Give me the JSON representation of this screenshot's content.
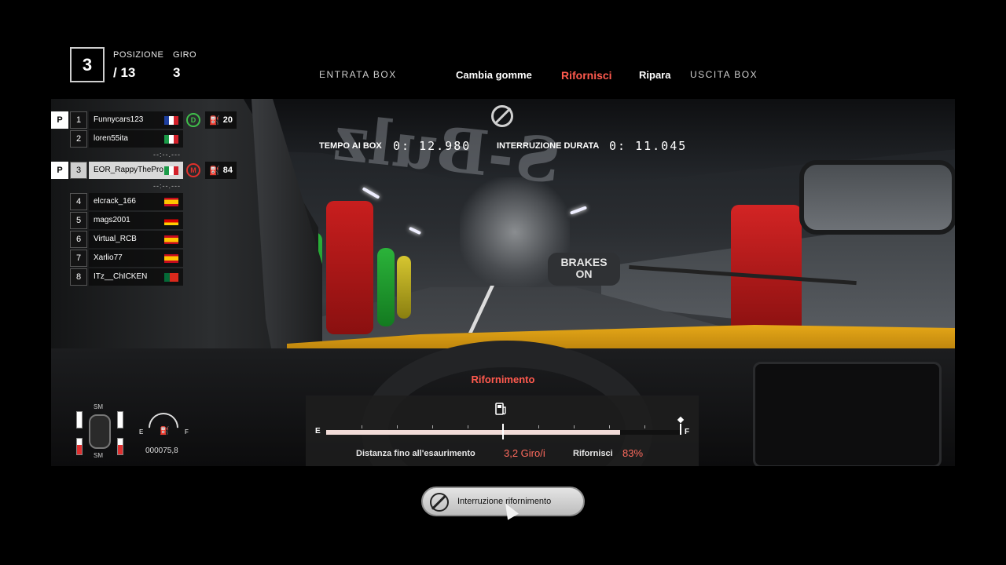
{
  "hud": {
    "position": "3",
    "position_label": "POSIZIONE",
    "position_total": "/ 13",
    "lap_label": "GIRO",
    "lap_value": "3"
  },
  "pit_menu": {
    "entry": "ENTRATA BOX",
    "tyres": "Cambia gomme",
    "refuel": "Rifornisci",
    "repair": "Ripara",
    "exit": "USCITA BOX"
  },
  "timers": {
    "pit_time_label": "TEMPO AI BOX",
    "pit_time_value": "0: 12.980",
    "stop_duration_label": "INTERRUZIONE DURATA",
    "stop_duration_value": "0: 11.045"
  },
  "leaderboard": {
    "rows": [
      {
        "pos": "1",
        "name": "Funnycars123",
        "flag": "fr",
        "p_badge": "P",
        "tyre": "D",
        "fuel": "20"
      },
      {
        "pos": "2",
        "name": "loren55ita",
        "flag": "it"
      },
      {
        "pos": "3",
        "name": "EOR_RappyThePro",
        "flag": "it",
        "p_badge": "P",
        "tyre": "M",
        "fuel": "84"
      },
      {
        "pos": "4",
        "name": "elcrack_166",
        "flag": "es"
      },
      {
        "pos": "5",
        "name": "mags2001",
        "flag": "de"
      },
      {
        "pos": "6",
        "name": "Virtual_RCB",
        "flag": "es"
      },
      {
        "pos": "7",
        "name": "Xarlio77",
        "flag": "es"
      },
      {
        "pos": "8",
        "name": "ITz__ChICKEN",
        "flag": "pt"
      }
    ],
    "gap_placeholder": "--:--.---"
  },
  "car_status": {
    "tyre_label_front": "SM",
    "tyre_label_rear": "SM",
    "gauge_e": "E",
    "gauge_f": "F",
    "odometer": "000075,8"
  },
  "scene": {
    "sign_text_1": "BRAKES",
    "sign_text_2": "ON"
  },
  "refuel": {
    "title": "Rifornimento",
    "bar_e": "E",
    "bar_f": "F",
    "level": 0.83,
    "distance_label": "Distanza fino all'esaurimento",
    "distance_value": "3,2 Giro/i",
    "refuel_label": "Rifornisci",
    "refuel_value": "83%"
  },
  "stop_button": {
    "label": "Interruzione rifornimento"
  },
  "colors": {
    "accent": "#ff5a4e",
    "tyre_d": "#3fbf4a",
    "tyre_m": "#e0302b"
  }
}
